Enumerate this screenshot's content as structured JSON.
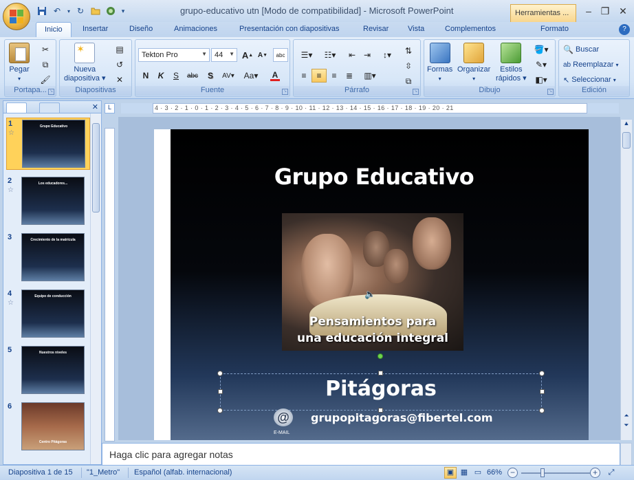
{
  "window": {
    "title": "grupo-educativo utn [Modo de compatibilidad] - Microsoft PowerPoint",
    "contextual_tab": "Herramientas ..."
  },
  "tabs": [
    "Inicio",
    "Insertar",
    "Diseño",
    "Animaciones",
    "Presentación con diapositivas",
    "Revisar",
    "Vista",
    "Complementos",
    "Formato"
  ],
  "ribbon": {
    "portapapeles": {
      "label": "Portapa...",
      "pegar": "Pegar"
    },
    "diapositivas": {
      "label": "Diapositivas",
      "nueva_line1": "Nueva",
      "nueva_line2": "diapositiva"
    },
    "fuente": {
      "label": "Fuente",
      "font_name": "Tekton Pro",
      "font_size": "44",
      "bold": "N",
      "italic": "K",
      "underline": "S",
      "strike": "abc",
      "shadow": "S",
      "spacing": "AV",
      "case": "Aa",
      "color": "A",
      "grow": "A",
      "shrink": "A"
    },
    "parrafo": {
      "label": "Párrafo"
    },
    "dibujo": {
      "label": "Dibujo",
      "formas": "Formas",
      "organizar": "Organizar",
      "estilos_line1": "Estilos",
      "estilos_line2": "rápidos"
    },
    "edicion": {
      "label": "Edición",
      "buscar": "Buscar",
      "reemplazar": "Reemplazar",
      "seleccionar": "Seleccionar"
    }
  },
  "ruler": "4 · 3 · 2 · 1 · 0 · 1 · 2 · 3 · 4 · 5 · 6 · 7 · 8 · 9 · 10 · 11 · 12 · 13 · 14 · 15 · 16 · 17 · 18 · 19 · 20 · 21",
  "thumbnails": [
    {
      "num": "1",
      "title": "Grupo Educativo",
      "has_star": true,
      "selected": true
    },
    {
      "num": "2",
      "title": "Los educadores...",
      "has_star": true,
      "selected": false
    },
    {
      "num": "3",
      "title": "Crecimiento de la matrícula",
      "has_star": false,
      "selected": false
    },
    {
      "num": "4",
      "title": "Equipo de conducción",
      "has_star": true,
      "selected": false
    },
    {
      "num": "5",
      "title": "Nuestros niveles",
      "has_star": false,
      "selected": false
    },
    {
      "num": "6",
      "title": "Centro Pitágoras",
      "has_star": false,
      "selected": false
    }
  ],
  "slide": {
    "title": "Grupo Educativo",
    "caption_line1": "Pensamientos para",
    "caption_line2": "una educación integral",
    "name": "Pitágoras",
    "email": "grupopitagoras@fibertel.com",
    "email_label": "E-MAIL"
  },
  "notes_placeholder": "Haga clic para agregar notas",
  "status": {
    "slide_info": "Diapositiva 1 de 15",
    "theme": "\"1_Metro\"",
    "language": "Español (alfab. internacional)",
    "zoom": "66%"
  },
  "colors": {
    "ribbon_blue": "#15428b",
    "highlight": "#f8c85f"
  }
}
